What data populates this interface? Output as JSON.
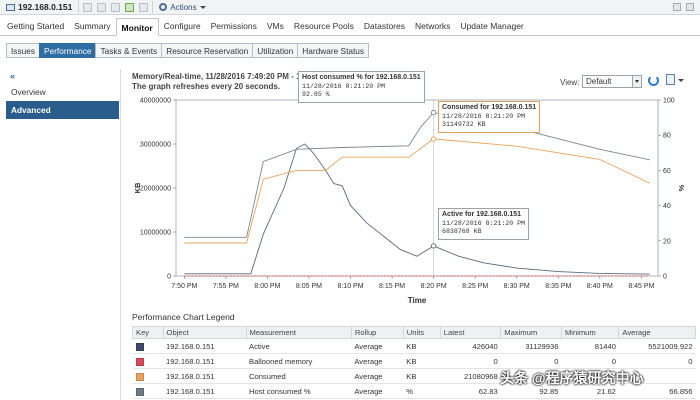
{
  "host": {
    "name": "192.168.0.151",
    "icon": "host-icon"
  },
  "toolbar": {
    "actions_label": "Actions",
    "icons": [
      "add-icon",
      "disconnect-icon",
      "vm-icon",
      "power-icon",
      "refresh-icon"
    ]
  },
  "main_tabs": [
    {
      "label": "Getting Started",
      "active": false
    },
    {
      "label": "Summary",
      "active": false
    },
    {
      "label": "Monitor",
      "active": true
    },
    {
      "label": "Configure",
      "active": false
    },
    {
      "label": "Permissions",
      "active": false
    },
    {
      "label": "VMs",
      "active": false
    },
    {
      "label": "Resource Pools",
      "active": false
    },
    {
      "label": "Datastores",
      "active": false
    },
    {
      "label": "Networks",
      "active": false
    },
    {
      "label": "Update Manager",
      "active": false
    }
  ],
  "sub_tabs": [
    {
      "label": "Issues",
      "active": false
    },
    {
      "label": "Performance",
      "active": true
    },
    {
      "label": "Tasks & Events",
      "active": false
    },
    {
      "label": "Resource Reservation",
      "active": false
    },
    {
      "label": "Utilization",
      "active": false
    },
    {
      "label": "Hardware Status",
      "active": false
    }
  ],
  "sidebar": {
    "collapse_glyph": "«",
    "items": [
      {
        "label": "Overview",
        "active": false
      },
      {
        "label": "Advanced",
        "active": true
      }
    ]
  },
  "chart": {
    "title": "Memory/Real-time, 11/28/2016 7:49:20 PM - 11/28",
    "subtitle": "The graph refreshes every 20 seconds.",
    "view_label": "View:",
    "view_value": "Default"
  },
  "chart_data": {
    "type": "line",
    "xlabel": "Time",
    "ylabel_left": "KB",
    "ylabel_right": "%",
    "ylim_left": [
      0,
      40000000
    ],
    "ylim_right": [
      0,
      100
    ],
    "y_ticks_left": [
      "0",
      "10000000",
      "20000000",
      "30000000",
      "40000000"
    ],
    "y_ticks_right": [
      "0",
      "20",
      "40",
      "60",
      "80",
      "100"
    ],
    "x_ticks": [
      "7:50 PM",
      "7:55 PM",
      "8:00 PM",
      "8:05 PM",
      "8:10 PM",
      "8:15 PM",
      "8:20 PM",
      "8:25 PM",
      "8:30 PM",
      "8:35 PM",
      "8:40 PM",
      "8:45 PM"
    ],
    "xlim_minutes": [
      -1,
      57
    ],
    "series": [
      {
        "name": "Active",
        "color": "#5a6b7b",
        "axis": "left",
        "points": [
          [
            0,
            500000
          ],
          [
            8,
            500000
          ],
          [
            9.5,
            9500000
          ],
          [
            12,
            20000000
          ],
          [
            13.5,
            29000000
          ],
          [
            14.5,
            30000000
          ],
          [
            15.5,
            28000000
          ],
          [
            17,
            24000000
          ],
          [
            18,
            21000000
          ],
          [
            19,
            20500000
          ],
          [
            20,
            16000000
          ],
          [
            22,
            12000000
          ],
          [
            24,
            9000000
          ],
          [
            26,
            6000000
          ],
          [
            28,
            4500000
          ],
          [
            30,
            6838768
          ],
          [
            33,
            4500000
          ],
          [
            36,
            3000000
          ],
          [
            40,
            1800000
          ],
          [
            45,
            1000000
          ],
          [
            50,
            600000
          ],
          [
            56,
            426040
          ]
        ]
      },
      {
        "name": "Ballooned memory",
        "color": "#d9534f",
        "axis": "left",
        "points": [
          [
            0,
            0
          ],
          [
            56,
            0
          ]
        ]
      },
      {
        "name": "Consumed",
        "color": "#e8a25a",
        "axis": "left",
        "points": [
          [
            0,
            7500000
          ],
          [
            7.5,
            7500000
          ],
          [
            9.5,
            22000000
          ],
          [
            13.5,
            24000000
          ],
          [
            17,
            24000000
          ],
          [
            19,
            27000000
          ],
          [
            27,
            27000000
          ],
          [
            30,
            31149732
          ],
          [
            40,
            29500000
          ],
          [
            50,
            26500000
          ],
          [
            56,
            21080968
          ]
        ]
      },
      {
        "name": "Host consumed %",
        "color": "#7a8792",
        "axis": "right",
        "points": [
          [
            0,
            22
          ],
          [
            7.5,
            22
          ],
          [
            9.5,
            65
          ],
          [
            13.5,
            72
          ],
          [
            19,
            73
          ],
          [
            27,
            74
          ],
          [
            28.5,
            85
          ],
          [
            30,
            92.85
          ],
          [
            40,
            84
          ],
          [
            50,
            72
          ],
          [
            56,
            66
          ]
        ]
      }
    ],
    "callouts": [
      {
        "title": "Host consumed % for 192.168.0.151",
        "time": "11/28/2016 8:21:20 PM",
        "value": "92.85 %"
      },
      {
        "title": "Consumed for 192.168.0.151",
        "time": "11/28/2016 8:21:20 PM",
        "value": "31149732 KB"
      },
      {
        "title": "Active for 192.168.0.151",
        "time": "11/28/2016 8:21:20 PM",
        "value": "6838768 KB"
      }
    ]
  },
  "legend": {
    "title": "Performance Chart Legend",
    "columns": [
      "Key",
      "Object",
      "Measurement",
      "Rollup",
      "Units",
      "Latest",
      "Maximum",
      "Minimum",
      "Average"
    ],
    "rows": [
      {
        "color": "#3d4a6b",
        "object": "192.168.0.151",
        "measurement": "Active",
        "rollup": "Average",
        "units": "KB",
        "latest": "426040",
        "maximum": "31129936",
        "minimum": "81440",
        "average": "5521009.922"
      },
      {
        "color": "#d64b59",
        "object": "192.168.0.151",
        "measurement": "Ballooned memory",
        "rollup": "Average",
        "units": "KB",
        "latest": "0",
        "maximum": "0",
        "minimum": "0",
        "average": "0"
      },
      {
        "color": "#e8a25a",
        "object": "192.168.0.151",
        "measurement": "Consumed",
        "rollup": "Average",
        "units": "KB",
        "latest": "21080968",
        "maximum": "",
        "minimum": "",
        "average": ""
      },
      {
        "color": "#6f7a85",
        "object": "192.168.0.151",
        "measurement": "Host consumed %",
        "rollup": "Average",
        "units": "%",
        "latest": "62.83",
        "maximum": "92.85",
        "minimum": "21.62",
        "average": "66.856"
      }
    ]
  },
  "watermark": "头条 @程序猿研究中心"
}
